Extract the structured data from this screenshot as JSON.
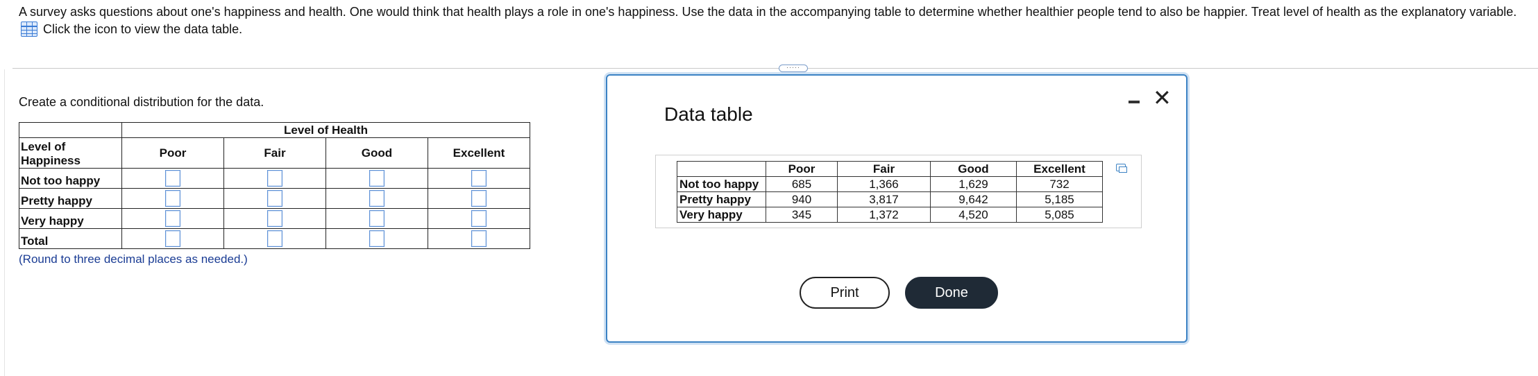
{
  "question": {
    "text": "A survey asks questions about one's happiness and health. One would think that health plays a role in one's happiness. Use the data in the accompanying table to determine whether healthier people tend to also be happier. Treat level of health as the explanatory variable.",
    "icon_link_text": "Click the icon to view the data table."
  },
  "divider_handle": "·····",
  "answer": {
    "prompt": "Create a conditional distribution for the data.",
    "super_header": "Level of Health",
    "row_header_title": "Level of Happiness",
    "columns": [
      "Poor",
      "Fair",
      "Good",
      "Excellent"
    ],
    "rows": [
      "Not too happy",
      "Pretty happy",
      "Very happy",
      "Total"
    ],
    "note": "(Round to three decimal places as needed.)"
  },
  "modal": {
    "title": "Data table",
    "columns": [
      "Poor",
      "Fair",
      "Good",
      "Excellent"
    ],
    "rows": [
      {
        "label": "Not too happy",
        "values": [
          "685",
          "1,366",
          "1,629",
          "732"
        ]
      },
      {
        "label": "Pretty happy",
        "values": [
          "940",
          "3,817",
          "9,642",
          "5,185"
        ]
      },
      {
        "label": "Very happy",
        "values": [
          "345",
          "1,372",
          "4,520",
          "5,085"
        ]
      }
    ],
    "print_label": "Print",
    "done_label": "Done",
    "close_glyph": "✕"
  }
}
